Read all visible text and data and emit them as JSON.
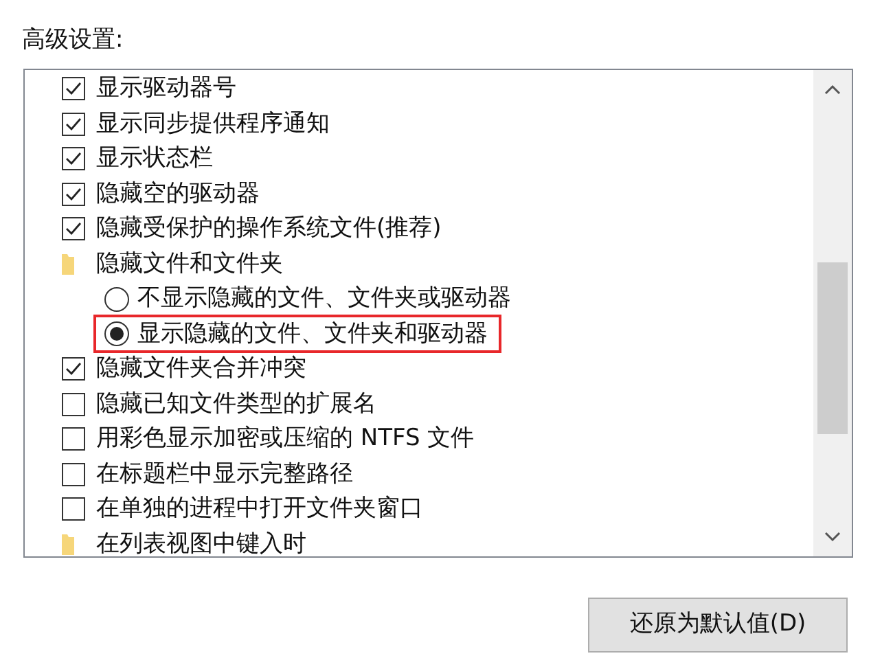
{
  "section_label": "高级设置:",
  "items": [
    {
      "kind": "checkbox",
      "label": "显示驱动器号",
      "checked": true
    },
    {
      "kind": "checkbox",
      "label": "显示同步提供程序通知",
      "checked": true
    },
    {
      "kind": "checkbox",
      "label": "显示状态栏",
      "checked": true
    },
    {
      "kind": "checkbox",
      "label": "隐藏空的驱动器",
      "checked": true
    },
    {
      "kind": "checkbox",
      "label": "隐藏受保护的操作系统文件(推荐)",
      "checked": true
    },
    {
      "kind": "folder",
      "label": "隐藏文件和文件夹",
      "children": [
        {
          "kind": "radio",
          "label": "不显示隐藏的文件、文件夹或驱动器",
          "selected": false,
          "highlighted": false
        },
        {
          "kind": "radio",
          "label": "显示隐藏的文件、文件夹和驱动器",
          "selected": true,
          "highlighted": true
        }
      ]
    },
    {
      "kind": "checkbox",
      "label": "隐藏文件夹合并冲突",
      "checked": true
    },
    {
      "kind": "checkbox",
      "label": "隐藏已知文件类型的扩展名",
      "checked": false
    },
    {
      "kind": "checkbox",
      "label": "用彩色显示加密或压缩的 NTFS 文件",
      "checked": false
    },
    {
      "kind": "checkbox",
      "label": "在标题栏中显示完整路径",
      "checked": false
    },
    {
      "kind": "checkbox",
      "label": "在单独的进程中打开文件夹窗口",
      "checked": false
    },
    {
      "kind": "folder",
      "label": "在列表视图中键入时"
    }
  ],
  "restore_button": "还原为默认值(D)"
}
